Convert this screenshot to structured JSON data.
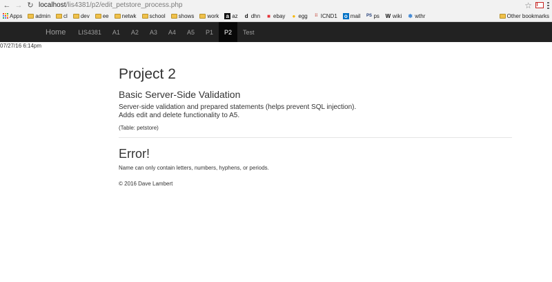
{
  "browser": {
    "url_host": "localhost",
    "url_path": "/lis4381/p2/edit_petstore_process.php"
  },
  "bookmarks": {
    "items": [
      {
        "label": "Apps",
        "icon": "apps-grid-icon"
      },
      {
        "label": "admin",
        "icon": "folder-icon"
      },
      {
        "label": "cl",
        "icon": "folder-icon"
      },
      {
        "label": "dev",
        "icon": "folder-icon"
      },
      {
        "label": "ee",
        "icon": "folder-icon"
      },
      {
        "label": "netwk",
        "icon": "folder-icon"
      },
      {
        "label": "school",
        "icon": "folder-icon"
      },
      {
        "label": "shows",
        "icon": "folder-icon"
      },
      {
        "label": "work",
        "icon": "folder-icon"
      },
      {
        "label": "az",
        "icon": "amazon-icon"
      },
      {
        "label": "dhn",
        "icon": "d-icon"
      },
      {
        "label": "ebay",
        "icon": "ebay-icon"
      },
      {
        "label": "egg",
        "icon": "egg-icon"
      },
      {
        "label": "ICND1",
        "icon": "cisco-icon"
      },
      {
        "label": "mail",
        "icon": "outlook-icon"
      },
      {
        "label": "ps",
        "icon": "ps-icon"
      },
      {
        "label": "wiki",
        "icon": "wikipedia-icon"
      },
      {
        "label": "wthr",
        "icon": "weather-icon"
      }
    ],
    "other": "Other bookmarks"
  },
  "navbar": {
    "brand": "Home",
    "items": [
      {
        "label": "LIS4381",
        "active": false
      },
      {
        "label": "A1",
        "active": false
      },
      {
        "label": "A2",
        "active": false
      },
      {
        "label": "A3",
        "active": false
      },
      {
        "label": "A4",
        "active": false
      },
      {
        "label": "A5",
        "active": false
      },
      {
        "label": "P1",
        "active": false
      },
      {
        "label": "P2",
        "active": true
      },
      {
        "label": "Test",
        "active": false
      }
    ]
  },
  "timestamp": "07/27/16 6:14pm",
  "content": {
    "title": "Project 2",
    "subtitle": "Basic Server-Side Validation",
    "desc_line1": "Server-side validation and prepared statements (helps prevent SQL injection).",
    "desc_line2": "Adds edit and delete functionality to A5.",
    "table_note": "(Table: petstore)",
    "error_title": "Error!",
    "error_message": "Name can only contain letters, numbers, hyphens, or periods.",
    "footer": "© 2016 Dave Lambert"
  }
}
